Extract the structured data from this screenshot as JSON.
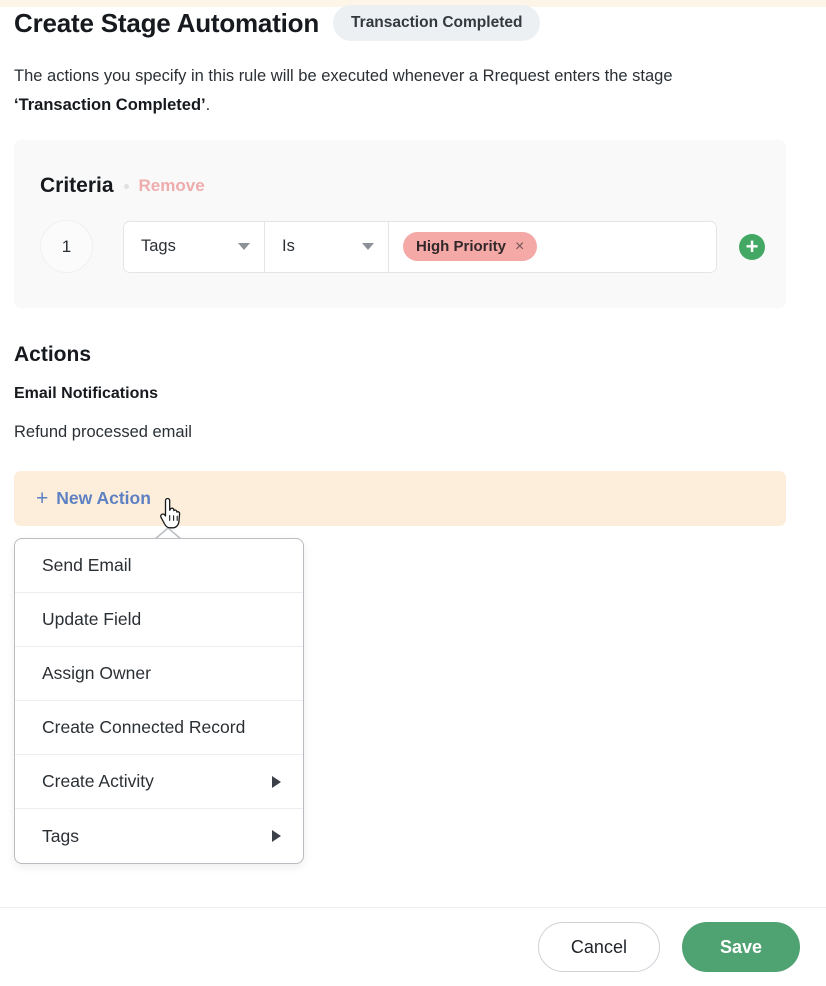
{
  "header": {
    "title": "Create Stage Automation",
    "stage_badge": "Transaction Completed"
  },
  "description": {
    "before": "The actions you specify in this rule will be executed whenever a Rrequest enters the stage ",
    "stage_emphasis": "‘Transaction Completed’",
    "after": "."
  },
  "criteria": {
    "title": "Criteria",
    "remove_label": "Remove",
    "rows": [
      {
        "index": "1",
        "field": "Tags",
        "operator": "Is",
        "value_chip": "High Priority",
        "chip_remove_icon": "×"
      }
    ],
    "add_icon": "+"
  },
  "actions": {
    "title": "Actions",
    "email_notifications_title": "Email Notifications",
    "email_notifications_items": [
      "Refund processed email"
    ],
    "new_action_label": "New Action",
    "new_action_plus": "+"
  },
  "action_menu": {
    "items": [
      {
        "label": "Send Email",
        "has_submenu": false
      },
      {
        "label": "Update Field",
        "has_submenu": false
      },
      {
        "label": "Assign Owner",
        "has_submenu": false
      },
      {
        "label": "Create Connected Record",
        "has_submenu": false
      },
      {
        "label": "Create Activity",
        "has_submenu": true
      },
      {
        "label": "Tags",
        "has_submenu": true
      }
    ]
  },
  "footer": {
    "cancel_label": "Cancel",
    "save_label": "Save"
  },
  "colors": {
    "accent_green": "#4fa271",
    "add_button_green": "#43a864",
    "new_action_bar": "#fdeedb",
    "new_action_text": "#5d80c3",
    "tag_chip": "#f5a9a6",
    "remove_link": "#eeadac",
    "criteria_card": "#f9f9fa",
    "stage_badge": "#edf0f2"
  }
}
